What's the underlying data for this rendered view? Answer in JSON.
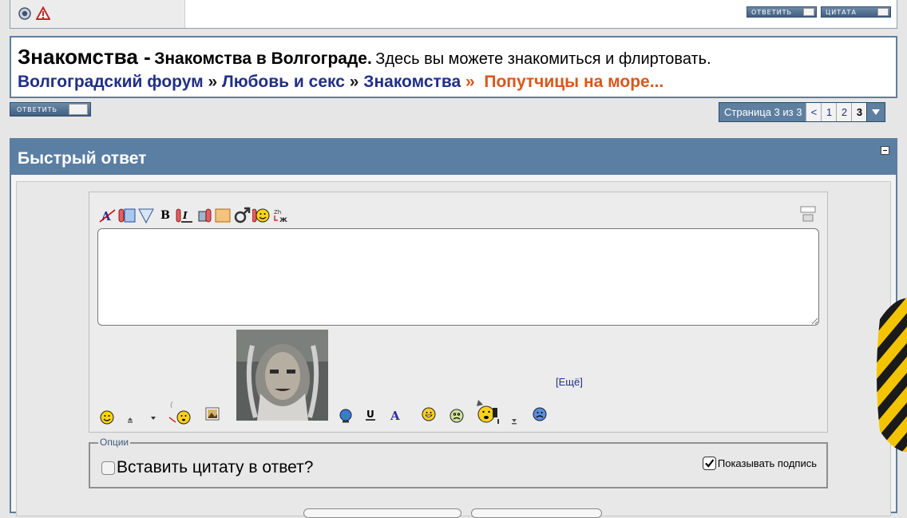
{
  "top_bar": {
    "reply_button": "ОТВЕТИТЬ",
    "quote_button": "ЦИТАТА"
  },
  "header": {
    "forum_title": "Знакомства -",
    "forum_subtitle": "Знакомства в Волгограде.",
    "forum_description": "Здесь вы можете знакомиться и флиртовать."
  },
  "breadcrumb": {
    "items": [
      "Волгоградский форум",
      "Любовь и секс",
      "Знакомства"
    ],
    "separator": "»",
    "current": "Попутчицы на море..."
  },
  "reply_button": "ОТВЕТИТЬ",
  "pagination": {
    "label": "Страница 3 из 3",
    "prev": "<",
    "pages": [
      "1",
      "2",
      "3"
    ],
    "current_page": "3"
  },
  "quick_reply": {
    "title": "Быстрый ответ",
    "editor_value": "",
    "more_smilies": "[Ещё]",
    "options_legend": "Опции",
    "quote_option": "Вставить цитату в ответ?",
    "quote_checked": false,
    "signature_option": "Показывать подпись",
    "signature_checked": true
  },
  "colors": {
    "accent": "#5b7ea3",
    "link": "#1f2f86",
    "current_crumb": "#d8561b"
  },
  "icons": {
    "toolbar": [
      "font-icon",
      "color-icon",
      "size-icon",
      "bold-icon",
      "italic-icon",
      "link-icon",
      "image-icon",
      "gender-icon",
      "smiley-icon",
      "translit-icon"
    ]
  }
}
